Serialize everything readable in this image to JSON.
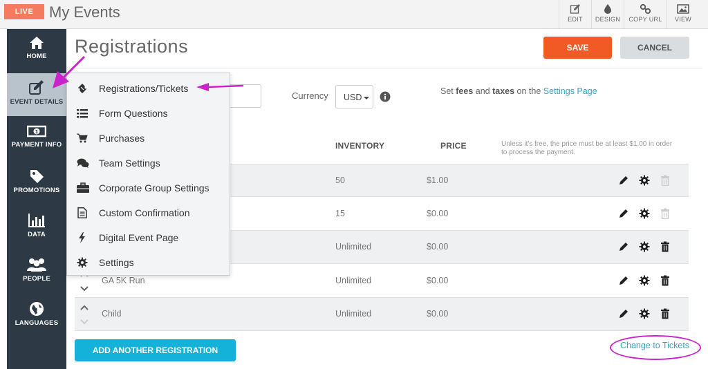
{
  "header": {
    "live_badge": "LIVE",
    "title": "My Events",
    "tools": [
      {
        "label": "EDIT",
        "icon": "edit-icon"
      },
      {
        "label": "DESIGN",
        "icon": "droplet-icon"
      },
      {
        "label": "COPY URL",
        "icon": "link-icon"
      },
      {
        "label": "VIEW",
        "icon": "image-icon"
      }
    ]
  },
  "sidebar": {
    "items": [
      {
        "label": "HOME",
        "icon": "home-icon"
      },
      {
        "label": "EVENT DETAILS",
        "icon": "edit-icon",
        "active": true
      },
      {
        "label": "PAYMENT INFO",
        "icon": "money-icon"
      },
      {
        "label": "PROMOTIONS",
        "icon": "tag-icon"
      },
      {
        "label": "DATA",
        "icon": "bar-chart-icon"
      },
      {
        "label": "PEOPLE",
        "icon": "people-icon"
      },
      {
        "label": "LANGUAGES",
        "icon": "globe-icon"
      }
    ]
  },
  "page": {
    "title": "Registrations",
    "save_label": "SAVE",
    "cancel_label": "CANCEL"
  },
  "settings": {
    "currency_label": "Currency",
    "currency_value": "USD",
    "fees_prefix": "Set ",
    "fees_bold": "fees",
    "fees_and": " and ",
    "taxes_bold": "taxes",
    "fees_suffix": " on the ",
    "settings_link": "Settings Page"
  },
  "table": {
    "headers": {
      "inventory": "INVENTORY",
      "price": "PRICE",
      "note": "Unless it's free, the price must be at least $1.00 in order to process the payment."
    },
    "rows": [
      {
        "name": "",
        "inventory": "50",
        "price": "$1.00",
        "deletable": false
      },
      {
        "name": "",
        "inventory": "15",
        "price": "$0.00",
        "deletable": false
      },
      {
        "name": "",
        "inventory": "Unlimited",
        "price": "$0.00",
        "deletable": true
      },
      {
        "name": "GA 5K Run",
        "inventory": "Unlimited",
        "price": "$0.00",
        "deletable": true
      },
      {
        "name": "Child",
        "inventory": "Unlimited",
        "price": "$0.00",
        "deletable": true
      }
    ]
  },
  "footer": {
    "add_label": "ADD ANOTHER REGISTRATION",
    "change_link": "Change to Tickets"
  },
  "menu": {
    "items": [
      {
        "label": "Registrations/Tickets",
        "icon": "ticket-icon"
      },
      {
        "label": "Form Questions",
        "icon": "list-icon"
      },
      {
        "label": "Purchases",
        "icon": "cart-icon"
      },
      {
        "label": "Team Settings",
        "icon": "chat-icon"
      },
      {
        "label": "Corporate Group Settings",
        "icon": "briefcase-icon"
      },
      {
        "label": "Custom Confirmation",
        "icon": "document-icon"
      },
      {
        "label": "Digital Event Page",
        "icon": "bolt-icon"
      },
      {
        "label": "Settings",
        "icon": "gear-icon"
      }
    ]
  },
  "colors": {
    "accent_save": "#f15a24",
    "accent_add": "#14b1d9",
    "link": "#29a9c9",
    "sidebar": "#2d3a45",
    "annotation": "#cc22cc"
  }
}
